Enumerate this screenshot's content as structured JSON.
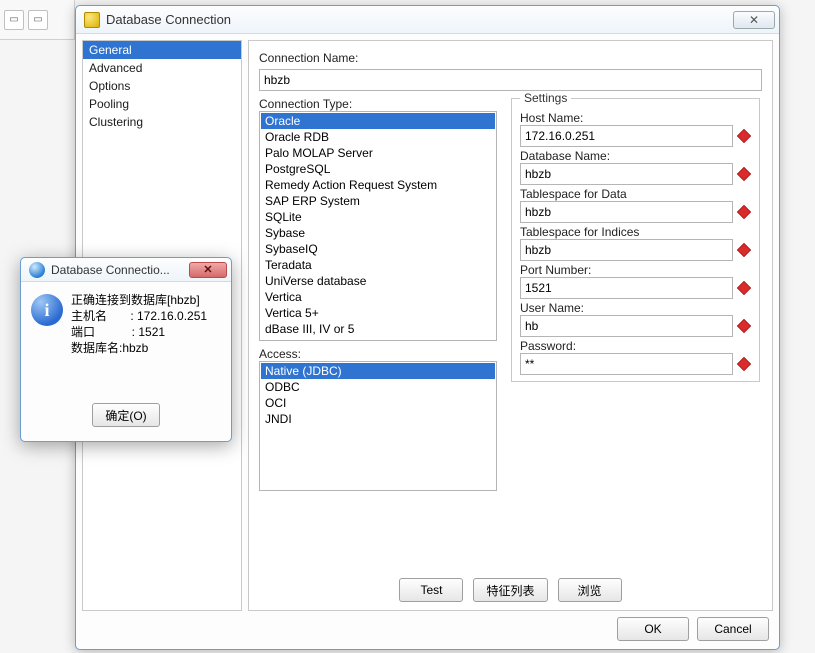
{
  "window": {
    "title": "Database Connection",
    "close_glyph": "✕"
  },
  "nav": {
    "items": [
      "General",
      "Advanced",
      "Options",
      "Pooling",
      "Clustering"
    ],
    "selected_index": 0
  },
  "connection_name": {
    "label": "Connection Name:",
    "value": "hbzb"
  },
  "connection_type": {
    "label": "Connection Type:",
    "options": [
      "Oracle",
      "Oracle RDB",
      "Palo MOLAP Server",
      "PostgreSQL",
      "Remedy Action Request System",
      "SAP ERP System",
      "SQLite",
      "Sybase",
      "SybaseIQ",
      "Teradata",
      "UniVerse database",
      "Vertica",
      "Vertica 5+",
      "dBase III, IV or 5"
    ],
    "selected_index": 0
  },
  "access": {
    "label": "Access:",
    "options": [
      "Native (JDBC)",
      "ODBC",
      "OCI",
      "JNDI"
    ],
    "selected_index": 0
  },
  "settings": {
    "legend": "Settings",
    "host_label": "Host Name:",
    "host_value": "172.16.0.251",
    "db_label": "Database Name:",
    "db_value": "hbzb",
    "ts_data_label": "Tablespace for Data",
    "ts_data_value": "hbzb",
    "ts_idx_label": "Tablespace for Indices",
    "ts_idx_value": "hbzb",
    "port_label": "Port Number:",
    "port_value": "1521",
    "user_label": "User Name:",
    "user_value": "hb",
    "pwd_label": "Password:",
    "pwd_value": "**"
  },
  "buttons": {
    "test": "Test",
    "feature": "特征列表",
    "browse": "浏览",
    "ok": "OK",
    "cancel": "Cancel"
  },
  "popup": {
    "title": "Database Connectio...",
    "close_glyph": "✕",
    "info_glyph": "i",
    "line1": "正确连接到数据库[hbzb]",
    "line2": "主机名       : 172.16.0.251",
    "line3": "端口           : 1521",
    "line4": "数据库名:hbzb",
    "ok": "确定(O)"
  }
}
